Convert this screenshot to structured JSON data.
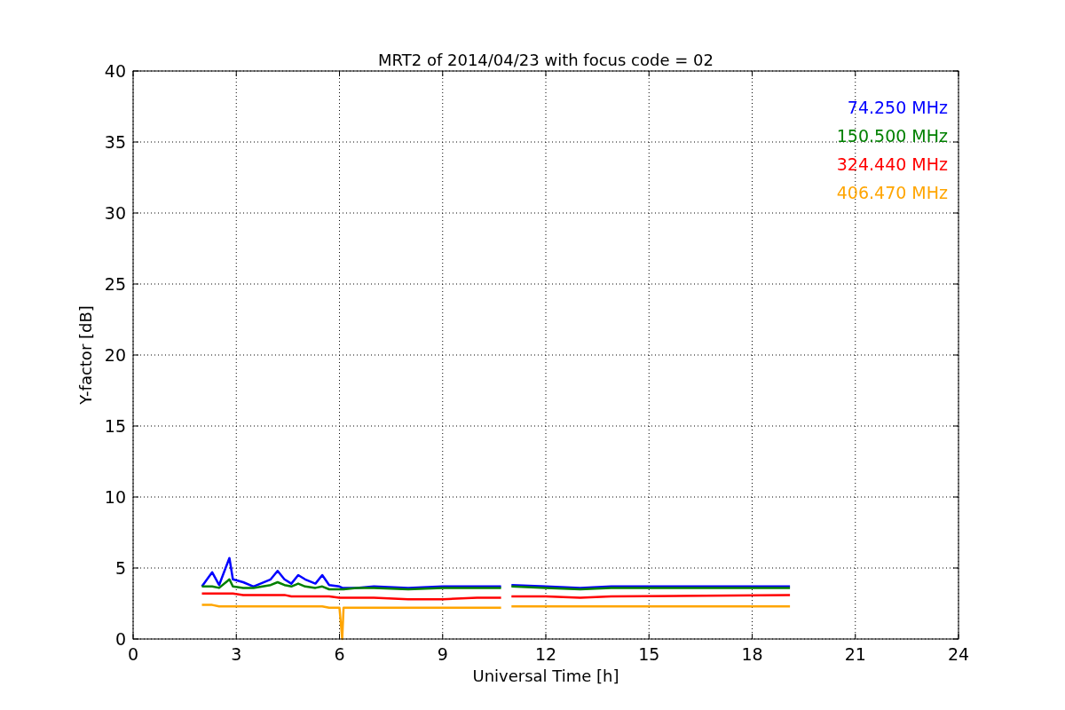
{
  "chart_data": {
    "type": "line",
    "title": "MRT2 of 2014/04/23 with focus code = 02",
    "xlabel": "Universal Time [h]",
    "ylabel": "Y-factor [dB]",
    "x": [
      2.0,
      2.3,
      2.5,
      2.8,
      2.9,
      3.2,
      3.5,
      4.0,
      4.2,
      4.4,
      4.6,
      4.8,
      5.0,
      5.3,
      5.5,
      5.7,
      6.0,
      6.08,
      6.12,
      6.5,
      7,
      8,
      9,
      10,
      10.7,
      10.8,
      11,
      12,
      13,
      13.9,
      19.1
    ],
    "series": [
      {
        "name": "74.250 MHz",
        "color": "#0000ff",
        "values": [
          3.7,
          4.7,
          3.8,
          5.7,
          4.2,
          4.0,
          3.7,
          4.2,
          4.8,
          4.2,
          3.9,
          4.5,
          4.2,
          3.9,
          4.5,
          3.8,
          3.7,
          3.6,
          3.6,
          3.6,
          3.7,
          3.6,
          3.7,
          3.7,
          3.7,
          null,
          3.8,
          3.7,
          3.6,
          3.7,
          3.7
        ]
      },
      {
        "name": "150.500 MHz",
        "color": "#008000",
        "values": [
          3.7,
          3.7,
          3.6,
          4.2,
          3.7,
          3.6,
          3.6,
          3.8,
          4.0,
          3.8,
          3.7,
          3.9,
          3.7,
          3.6,
          3.7,
          3.5,
          3.5,
          3.5,
          3.5,
          3.6,
          3.6,
          3.5,
          3.6,
          3.6,
          3.6,
          null,
          3.7,
          3.6,
          3.5,
          3.6,
          3.6
        ]
      },
      {
        "name": "324.440 MHz",
        "color": "#ff0000",
        "values": [
          3.2,
          3.2,
          3.2,
          3.2,
          3.2,
          3.1,
          3.1,
          3.1,
          3.1,
          3.1,
          3.0,
          3.0,
          3.0,
          3.0,
          3.0,
          3.0,
          2.9,
          2.9,
          2.9,
          2.9,
          2.9,
          2.8,
          2.8,
          2.9,
          2.9,
          null,
          3.0,
          3.0,
          2.9,
          3.0,
          3.1
        ]
      },
      {
        "name": "406.470 MHz",
        "color": "#ffa500",
        "values": [
          2.4,
          2.4,
          2.3,
          2.3,
          2.3,
          2.3,
          2.3,
          2.3,
          2.3,
          2.3,
          2.3,
          2.3,
          2.3,
          2.3,
          2.3,
          2.2,
          2.2,
          0,
          2.2,
          2.2,
          2.2,
          2.2,
          2.2,
          2.2,
          2.2,
          null,
          2.3,
          2.3,
          2.3,
          2.3,
          2.3
        ]
      }
    ],
    "grid": true,
    "xlim": [
      0,
      24
    ],
    "ylim": [
      0,
      40
    ],
    "xticks": [
      0,
      3,
      6,
      9,
      12,
      15,
      18,
      21,
      24
    ],
    "yticks": [
      0,
      5,
      10,
      15,
      20,
      25,
      30,
      35,
      40
    ]
  }
}
